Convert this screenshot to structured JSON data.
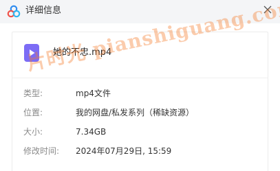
{
  "window": {
    "title": "详细信息",
    "icon": "app-logo-icon",
    "close_icon": "close-icon"
  },
  "file": {
    "name": "她的不忠.mp4",
    "icon": "video-file-icon",
    "icon_color": "#7c6cf5"
  },
  "details": [
    {
      "label": "类型:",
      "value": "mp4文件"
    },
    {
      "label": "位置:",
      "value": "我的网盘/私发系列（稀缺资源）"
    },
    {
      "label": "大小:",
      "value": "7.34GB"
    },
    {
      "label": "修改时间:",
      "value": "2024年07月29日, 15:59"
    }
  ],
  "watermark": {
    "text": "片时光 pianshiguang.com",
    "color": "#f57828"
  }
}
